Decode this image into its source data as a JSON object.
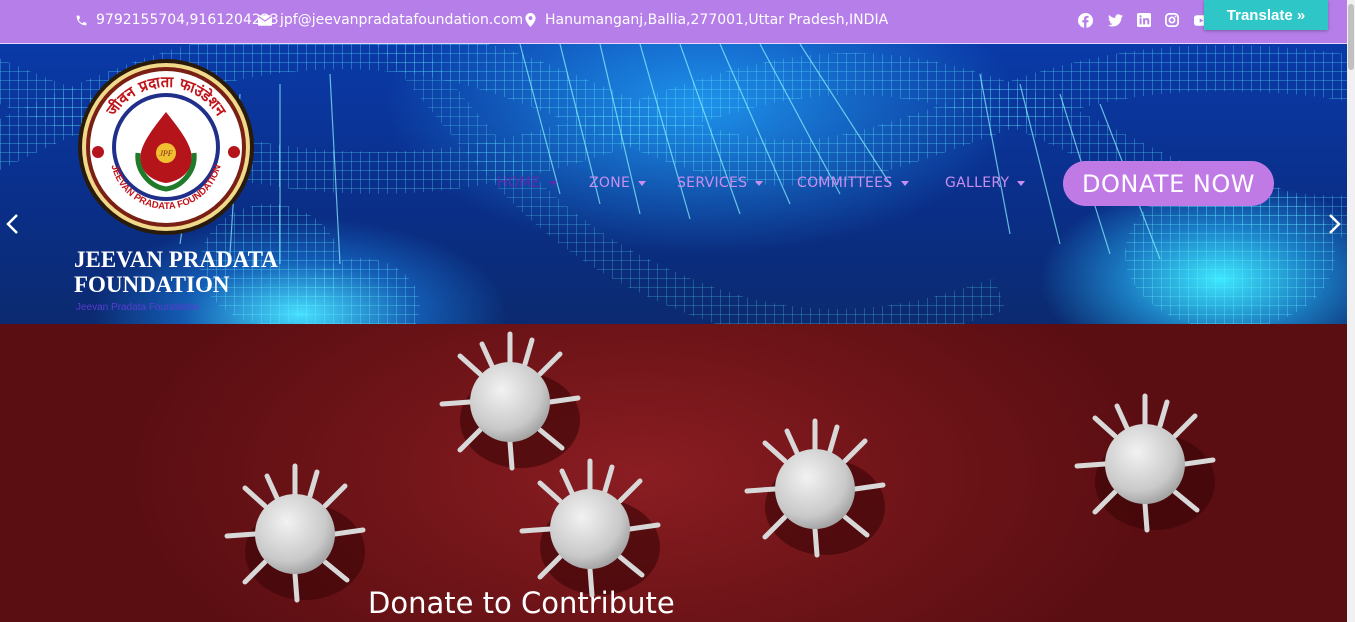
{
  "topbar": {
    "phone": "9792155704,9161204223",
    "email": "jpf@jeevanpradatafoundation.com",
    "address": "Hanumanganj,Ballia,277001,Uttar Pradesh,INDIA",
    "social_icons": [
      "facebook-icon",
      "twitter-icon",
      "linkedin-icon",
      "instagram-icon",
      "youtube-icon"
    ],
    "translate_label": "Translate »",
    "bg_color": "#b57ee9",
    "translate_color": "#2ec6c7"
  },
  "logo": {
    "arc_text": "जीवन प्रदाता फाउंडेशन",
    "bottom_text": "JEEVAN PRADATA FOUNDATION",
    "center_text": "JPF"
  },
  "site": {
    "title_line1": "JEEVAN PRADATA",
    "title_line2": "FOUNDATION",
    "tagline": "Jeevan Pradata Foundation"
  },
  "nav": {
    "items": [
      {
        "label": "HOME",
        "active": true
      },
      {
        "label": "ZONE"
      },
      {
        "label": "SERVICES"
      },
      {
        "label": "COMMITTEES"
      },
      {
        "label": "GALLERY"
      }
    ],
    "active_color": "#5a2bb0",
    "item_color": "#c98ef0",
    "donate_label": "DONATE NOW",
    "donate_color": "#c07ae6"
  },
  "slider": {
    "prev_icon": "chevron-left-icon",
    "next_icon": "chevron-right-icon"
  },
  "section": {
    "heading": "Donate to Contribute",
    "bg_color": "#6e1418"
  }
}
